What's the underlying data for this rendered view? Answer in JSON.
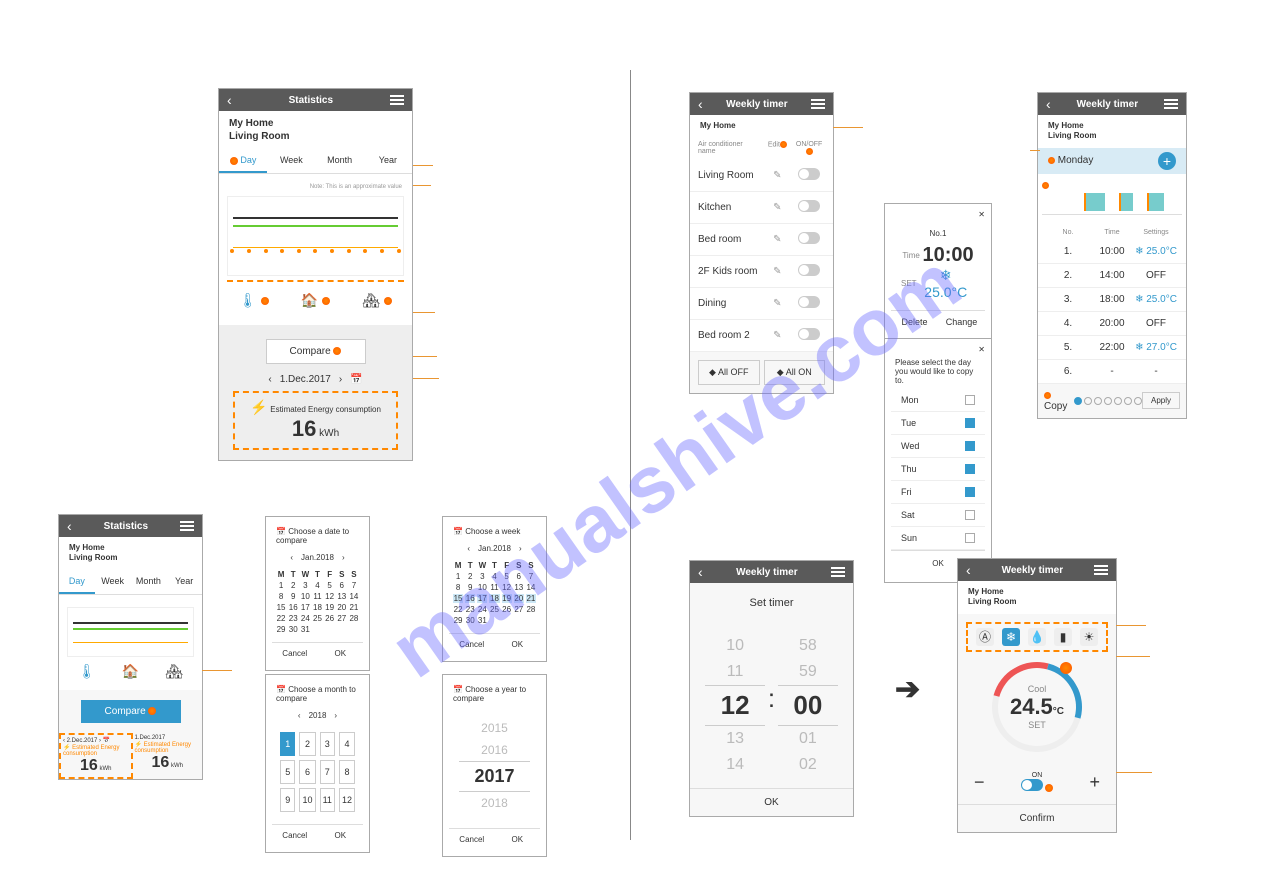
{
  "watermark": "manualshive.com",
  "stats": {
    "title": "Statistics",
    "home": "My Home",
    "room": "Living Room",
    "tabs": [
      "Day",
      "Week",
      "Month",
      "Year"
    ],
    "note": "Note: This is an approximate value",
    "compare": "Compare",
    "date": "1.Dec.2017",
    "energy_label": "Estimated Energy consumption",
    "energy_value": "16",
    "energy_unit": "kWh"
  },
  "stats2": {
    "title": "Statistics",
    "home": "My Home",
    "room": "Living Room",
    "tabs": [
      "Day",
      "Week",
      "Month",
      "Year"
    ],
    "compare": "Compare",
    "date_left": "2.Dec.2017",
    "date_right": "1.Dec.2017",
    "label_left": "Estimated Energy consumption",
    "label_right": "Estimated Energy consumption",
    "val_left": "16",
    "val_right": "16",
    "unit": "kWh"
  },
  "cal_date": {
    "header": "Choose a date to compare",
    "month": "Jan.2018",
    "dow": [
      "M",
      "T",
      "W",
      "T",
      "F",
      "S",
      "S"
    ],
    "cancel": "Cancel",
    "ok": "OK"
  },
  "cal_week": {
    "header": "Choose a week",
    "month": "Jan.2018",
    "cancel": "Cancel",
    "ok": "OK"
  },
  "cal_month": {
    "header": "Choose a month to compare",
    "year": "2018",
    "months": [
      "1",
      "2",
      "3",
      "4",
      "5",
      "6",
      "7",
      "8",
      "9",
      "10",
      "11",
      "12"
    ],
    "cancel": "Cancel",
    "ok": "OK"
  },
  "cal_year": {
    "header": "Choose a year to compare",
    "years": [
      "2015",
      "2016",
      "2017",
      "2018"
    ],
    "cancel": "Cancel",
    "ok": "OK"
  },
  "weekly_list": {
    "title": "Weekly timer",
    "home": "My Home",
    "col_name": "Air conditioner name",
    "col_edit": "Edit",
    "col_onoff": "ON/OFF",
    "rooms": [
      "Living Room",
      "Kitchen",
      "Bed room",
      "2F Kids room",
      "Dining",
      "Bed room 2"
    ],
    "all_off": "All OFF",
    "all_on": "All ON"
  },
  "timer_popup": {
    "no": "No.1",
    "time_label": "Time",
    "time": "10:00",
    "set_label": "SET",
    "set_temp": "25.0",
    "unit": "°C",
    "delete": "Delete",
    "change": "Change"
  },
  "copy_popup": {
    "msg": "Please select the day you would like to copy to.",
    "days": [
      "Mon",
      "Tue",
      "Wed",
      "Thu",
      "Fri",
      "Sat",
      "Sun"
    ],
    "ok": "OK"
  },
  "weekly_detail": {
    "title": "Weekly timer",
    "home": "My Home",
    "room": "Living Room",
    "day": "Monday",
    "col_no": "No.",
    "col_time": "Time",
    "col_settings": "Settings",
    "rows": [
      {
        "no": "1.",
        "time": "10:00",
        "set": "25.0°C",
        "on": true
      },
      {
        "no": "2.",
        "time": "14:00",
        "set": "OFF",
        "on": false
      },
      {
        "no": "3.",
        "time": "18:00",
        "set": "25.0°C",
        "on": true
      },
      {
        "no": "4.",
        "time": "20:00",
        "set": "OFF",
        "on": false
      },
      {
        "no": "5.",
        "time": "22:00",
        "set": "27.0°C",
        "on": true
      },
      {
        "no": "6.",
        "time": "-",
        "set": "-",
        "on": false
      }
    ],
    "copy": "Copy",
    "apply": "Apply"
  },
  "set_timer": {
    "title": "Weekly timer",
    "label": "Set timer",
    "hours": [
      "10",
      "11",
      "12",
      "13",
      "14"
    ],
    "mins": [
      "58",
      "59",
      "00",
      "01",
      "02"
    ],
    "ok": "OK"
  },
  "set_mode": {
    "title": "Weekly timer",
    "home": "My Home",
    "room": "Living Room",
    "mode": "Cool",
    "temp": "24.5",
    "unit": "°C",
    "sub": "SET",
    "on": "ON",
    "confirm": "Confirm"
  },
  "common": {
    "icon_cal": "📅"
  }
}
